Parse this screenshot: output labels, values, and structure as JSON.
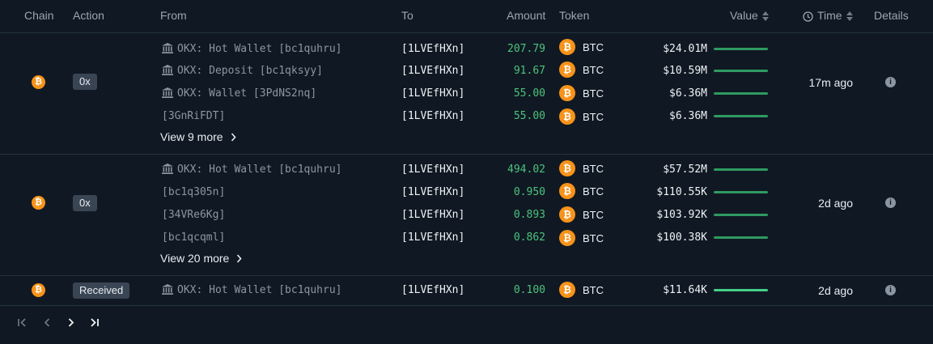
{
  "header": {
    "chain": "Chain",
    "action": "Action",
    "from": "From",
    "to": "To",
    "amount": "Amount",
    "token": "Token",
    "value": "Value",
    "time": "Time",
    "details": "Details"
  },
  "colors": {
    "background": "#101923",
    "amount_green": "#4cc37c",
    "btc_orange": "#f7931a",
    "bar_green": "#2f9a62",
    "bar_bright": "#45d08a"
  },
  "chain_icon": "bitcoin-icon",
  "groups": [
    {
      "action": "0x",
      "time": "17m ago",
      "rows": [
        {
          "from": "OKX: Hot Wallet [bc1quhru]",
          "entity": true,
          "to": "[1LVEfHXn]",
          "amount": "207.79",
          "token": "BTC",
          "value": "$24.01M"
        },
        {
          "from": "OKX: Deposit [bc1qksyy]",
          "entity": true,
          "to": "[1LVEfHXn]",
          "amount": "91.67",
          "token": "BTC",
          "value": "$10.59M"
        },
        {
          "from": "OKX: Wallet [3PdNS2nq]",
          "entity": true,
          "to": "[1LVEfHXn]",
          "amount": "55.00",
          "token": "BTC",
          "value": "$6.36M"
        },
        {
          "from": "[3GnRiFDT]",
          "entity": false,
          "to": "[1LVEfHXn]",
          "amount": "55.00",
          "token": "BTC",
          "value": "$6.36M"
        }
      ],
      "more": "View 9 more"
    },
    {
      "action": "0x",
      "time": "2d ago",
      "rows": [
        {
          "from": "OKX: Hot Wallet [bc1quhru]",
          "entity": true,
          "to": "[1LVEfHXn]",
          "amount": "494.02",
          "token": "BTC",
          "value": "$57.52M"
        },
        {
          "from": "[bc1q305n]",
          "entity": false,
          "to": "[1LVEfHXn]",
          "amount": "0.950",
          "token": "BTC",
          "value": "$110.55K"
        },
        {
          "from": "[34VRe6Kg]",
          "entity": false,
          "to": "[1LVEfHXn]",
          "amount": "0.893",
          "token": "BTC",
          "value": "$103.92K"
        },
        {
          "from": "[bc1qcqml]",
          "entity": false,
          "to": "[1LVEfHXn]",
          "amount": "0.862",
          "token": "BTC",
          "value": "$100.38K"
        }
      ],
      "more": "View 20 more"
    },
    {
      "action": "Received",
      "time": "2d ago",
      "rows": [
        {
          "from": "OKX: Hot Wallet [bc1quhru]",
          "entity": true,
          "to": "[1LVEfHXn]",
          "amount": "0.100",
          "token": "BTC",
          "value": "$11.64K"
        }
      ]
    }
  ],
  "pagination": {
    "first_icon": "first-page-icon",
    "prev_icon": "prev-page-icon",
    "next_icon": "next-page-icon",
    "last_icon": "last-page-icon"
  }
}
